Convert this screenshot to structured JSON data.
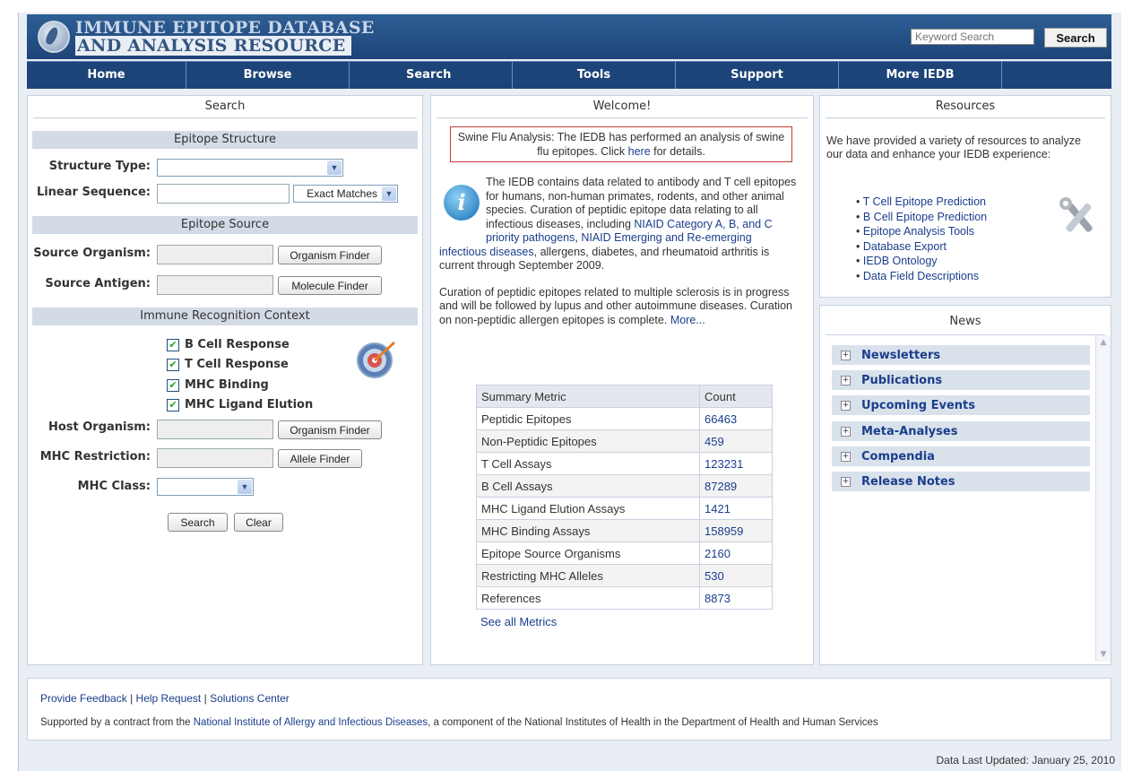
{
  "header": {
    "logo_line1": "IMMUNE EPITOPE DATABASE",
    "logo_line2": "AND ANALYSIS RESOURCE",
    "search_placeholder": "Keyword Search",
    "search_button": "Search"
  },
  "nav": [
    "Home",
    "Browse",
    "Search",
    "Tools",
    "Support",
    "More IEDB"
  ],
  "search_panel": {
    "title": "Search",
    "structure_section": "Epitope Structure",
    "structure_type_label": "Structure Type:",
    "linear_sequence_label": "Linear Sequence:",
    "exact_matches": "Exact Matches",
    "source_section": "Epitope Source",
    "source_organism_label": "Source Organism:",
    "source_antigen_label": "Source Antigen:",
    "organism_finder": "Organism Finder",
    "molecule_finder": "Molecule Finder",
    "context_section": "Immune Recognition Context",
    "checkboxes": [
      "B Cell Response",
      "T Cell Response",
      "MHC Binding",
      "MHC Ligand Elution"
    ],
    "host_organism_label": "Host Organism:",
    "mhc_restriction_label": "MHC Restriction:",
    "allele_finder": "Allele Finder",
    "mhc_class_label": "MHC Class:",
    "search_button": "Search",
    "clear_button": "Clear"
  },
  "welcome": {
    "title": "Welcome!",
    "notice_pre": "Swine Flu Analysis: The IEDB has performed an analysis of swine flu epitopes. Click ",
    "notice_link": "here",
    "notice_post": " for details.",
    "para1_a": "The IEDB contains data related to antibody and T cell epitopes for humans, non-human primates, rodents, and other animal species. Curation of peptidic epitope data relating to all infectious diseases, including ",
    "para1_link1": "NIAID Category A, B, and C priority pathogens",
    "para1_b": ", ",
    "para1_link2": "NIAID Emerging and Re-emerging infectious diseases",
    "para1_c": ", allergens, diabetes, and rheumatoid arthritis is current through September 2009.",
    "para2": "Curation of peptidic epitopes related to multiple sclerosis is in progress and will be followed by lupus and other autoimmune diseases. Curation on non-peptidic allergen epitopes is complete. ",
    "more_link": "More...",
    "table_header": [
      "Summary Metric",
      "Count"
    ],
    "metrics": [
      [
        "Peptidic Epitopes",
        "66463"
      ],
      [
        "Non-Peptidic Epitopes",
        "459"
      ],
      [
        "T Cell Assays",
        "123231"
      ],
      [
        "B Cell Assays",
        "87289"
      ],
      [
        "MHC Ligand Elution Assays",
        "1421"
      ],
      [
        "MHC Binding Assays",
        "158959"
      ],
      [
        "Epitope Source Organisms",
        "2160"
      ],
      [
        "Restricting MHC Alleles",
        "530"
      ],
      [
        "References",
        "8873"
      ]
    ],
    "see_all": "See all Metrics"
  },
  "resources": {
    "title": "Resources",
    "intro": "We have provided a variety of resources to analyze our data and enhance your IEDB experience:",
    "items": [
      "T Cell Epitope Prediction",
      "B Cell Epitope Prediction",
      "Epitope Analysis Tools",
      "Database Export",
      "IEDB Ontology",
      "Data Field Descriptions"
    ]
  },
  "news": {
    "title": "News",
    "items": [
      "Newsletters",
      "Publications",
      "Upcoming Events",
      "Meta-Analyses",
      "Compendia",
      "Release Notes"
    ]
  },
  "footer": {
    "link1": "Provide Feedback",
    "link2": "Help Request",
    "link3": "Solutions Center",
    "sep": "|",
    "support_pre": "Supported by a contract from the ",
    "support_link": "National Institute of Allergy and Infectious Diseases",
    "support_post": ", a component of the National Institutes of Health in the Department of Health and Human Services",
    "updated": "Data Last Updated: January 25, 2010"
  },
  "colors": {
    "banner": "#1d4478",
    "link": "#1a3e8c",
    "section_bar": "#d3dbe6"
  },
  "icons": [
    "logo-icon",
    "target-icon",
    "info-icon",
    "tools-icon",
    "checkbox-icon",
    "expand-icon",
    "dropdown-arrow-icon"
  ]
}
